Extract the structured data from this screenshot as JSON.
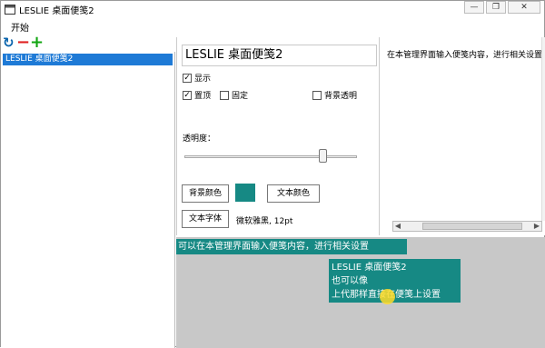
{
  "window": {
    "title": "LESLIE 桌面便笺2",
    "minimize": "—",
    "restore": "❐",
    "close": "✕"
  },
  "menu": {
    "start": "开始"
  },
  "toolbar": {
    "refresh_icon": "refresh-icon",
    "remove_icon": "minus-icon",
    "add_icon": "plus-icon"
  },
  "notes_list": {
    "items": [
      "LESLIE 桌面便笺2"
    ]
  },
  "settings": {
    "note_title": "LESLIE 桌面便笺2",
    "show_label": "显示",
    "show_checked": true,
    "top_label": "置顶",
    "top_checked": true,
    "fixed_label": "固定",
    "fixed_checked": false,
    "bg_transparent_label": "背景透明",
    "bg_transparent_checked": false,
    "opacity_label": "透明度：",
    "opacity_value": 0.8,
    "bg_color_button": "背景颜色",
    "bg_color": "#168984",
    "text_color_button": "文本颜色",
    "font_button": "文本字体",
    "font_value": "微软雅黑, 12pt"
  },
  "preview": {
    "text": "在本管理界面输入便笺内容，进行相关设置"
  },
  "desktop": {
    "banner_text": "可以在本管理界面输入便笺内容，进行相关设置",
    "note_lines": [
      "LESLIE 桌面便笺2",
      "也可以像",
      "上代那样直接在便笺上设置"
    ]
  }
}
